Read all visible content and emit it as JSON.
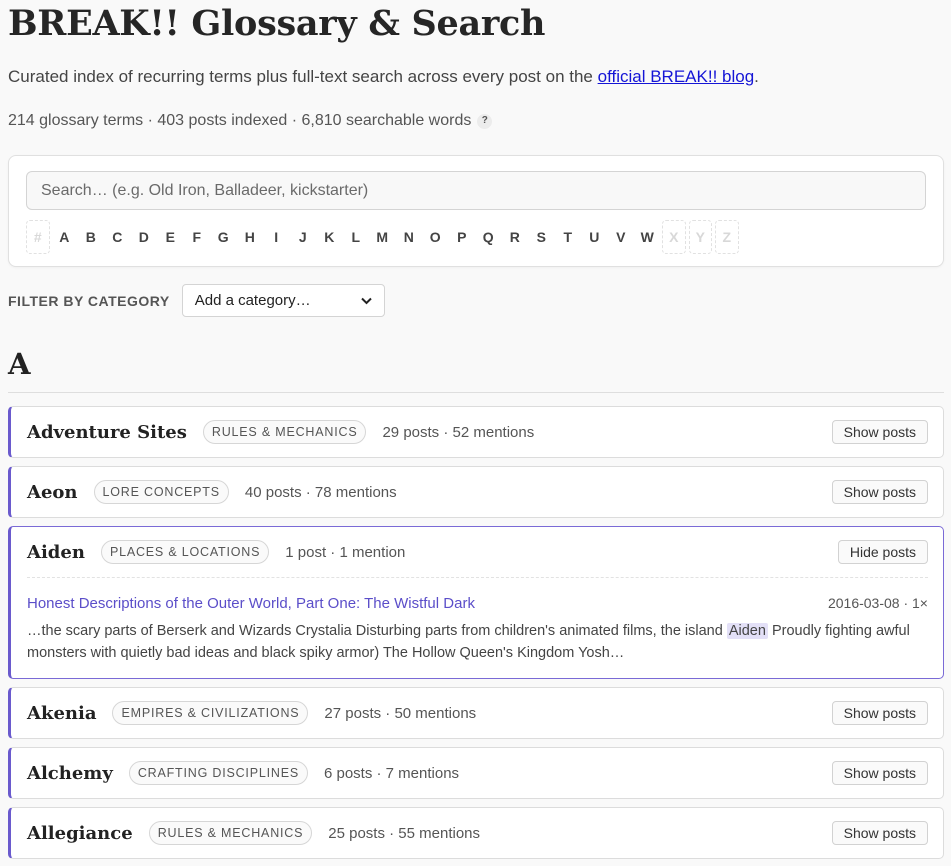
{
  "header": {
    "title": "BREAK!! Glossary & Search",
    "lede_prefix": "Curated index of recurring terms plus full-text search across every post on the ",
    "lede_link": "official BREAK!! blog",
    "lede_suffix": ".",
    "stats": "214 glossary terms · 403 posts indexed · 6,810 searchable words",
    "help_icon_text": "?"
  },
  "search": {
    "placeholder": "Search… (e.g. Old Iron, Balladeer, kickstarter)",
    "value": ""
  },
  "alphabet": [
    {
      "label": "#",
      "enabled": false
    },
    {
      "label": "A",
      "enabled": true
    },
    {
      "label": "B",
      "enabled": true
    },
    {
      "label": "C",
      "enabled": true
    },
    {
      "label": "D",
      "enabled": true
    },
    {
      "label": "E",
      "enabled": true
    },
    {
      "label": "F",
      "enabled": true
    },
    {
      "label": "G",
      "enabled": true
    },
    {
      "label": "H",
      "enabled": true
    },
    {
      "label": "I",
      "enabled": true
    },
    {
      "label": "J",
      "enabled": true
    },
    {
      "label": "K",
      "enabled": true
    },
    {
      "label": "L",
      "enabled": true
    },
    {
      "label": "M",
      "enabled": true
    },
    {
      "label": "N",
      "enabled": true
    },
    {
      "label": "O",
      "enabled": true
    },
    {
      "label": "P",
      "enabled": true
    },
    {
      "label": "Q",
      "enabled": true
    },
    {
      "label": "R",
      "enabled": true
    },
    {
      "label": "S",
      "enabled": true
    },
    {
      "label": "T",
      "enabled": true
    },
    {
      "label": "U",
      "enabled": true
    },
    {
      "label": "V",
      "enabled": true
    },
    {
      "label": "W",
      "enabled": true
    },
    {
      "label": "X",
      "enabled": false
    },
    {
      "label": "Y",
      "enabled": false
    },
    {
      "label": "Z",
      "enabled": false
    }
  ],
  "filter": {
    "label": "FILTER BY CATEGORY",
    "selected": "Add a category…"
  },
  "section": {
    "letter": "A"
  },
  "entries": [
    {
      "term": "Adventure Sites",
      "category": "RULES & MECHANICS",
      "meta": "29 posts · 52 mentions",
      "button": "Show posts",
      "open": false
    },
    {
      "term": "Aeon",
      "category": "LORE CONCEPTS",
      "meta": "40 posts · 78 mentions",
      "button": "Show posts",
      "open": false
    },
    {
      "term": "Aiden",
      "category": "PLACES & LOCATIONS",
      "meta": "1 post · 1 mention",
      "button": "Hide posts",
      "open": true,
      "post": {
        "title": "Honest Descriptions of the Outer World, Part One: The Wistful Dark",
        "meta": "2016-03-08 · 1×",
        "snippet_before": "…the scary parts of Berserk and Wizards Crystalia Disturbing parts from children's animated films, the island ",
        "snippet_highlight": "Aiden",
        "snippet_after": " Proudly fighting awful monsters with quietly bad ideas and black spiky armor) The Hollow Queen's Kingdom Yosh…"
      }
    },
    {
      "term": "Akenia",
      "category": "EMPIRES & CIVILIZATIONS",
      "meta": "27 posts · 50 mentions",
      "button": "Show posts",
      "open": false
    },
    {
      "term": "Alchemy",
      "category": "CRAFTING DISCIPLINES",
      "meta": "6 posts · 7 mentions",
      "button": "Show posts",
      "open": false
    },
    {
      "term": "Allegiance",
      "category": "RULES & MECHANICS",
      "meta": "25 posts · 55 mentions",
      "button": "Show posts",
      "open": false
    }
  ],
  "colors": {
    "accent": "#6a5acd",
    "link": "#1515d6",
    "highlight": "#e3e0f7"
  }
}
